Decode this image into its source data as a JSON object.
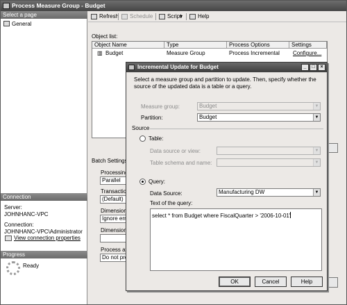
{
  "window": {
    "title": "Process Measure Group - Budget"
  },
  "left_pane": {
    "select_page_header": "Select a page",
    "pages": [
      {
        "label": "General",
        "icon": "page-icon"
      }
    ],
    "connection_header": "Connection",
    "server_label": "Server:",
    "server_value": "JOHNHANC-VPC",
    "connection_label": "Connection:",
    "connection_value": "JOHNHANC-VPC\\Administrator",
    "view_connection_properties": "View connection properties",
    "progress_header": "Progress",
    "progress_status": "Ready"
  },
  "toolbar": {
    "refresh": "Refresh",
    "schedule": "Schedule",
    "script": "Script",
    "help": "Help"
  },
  "object_list": {
    "label": "Object list:",
    "columns": [
      "Object Name",
      "Type",
      "Process Options",
      "Settings"
    ],
    "rows": [
      {
        "name": "Budget",
        "type": "Measure Group",
        "process_options": "Process Incremental",
        "settings": "Configure..."
      }
    ]
  },
  "batch_settings": {
    "label": "Batch Settings S",
    "processing_label": "Processing",
    "processing_value": "Parallel",
    "transaction_label": "Transaction",
    "transaction_value": "(Default)",
    "dimension_errors_label": "Dimension e",
    "dimension_errors_value": "Ignore error",
    "dimension_key_label": "Dimension k",
    "process_affected_label": "Process affe",
    "process_affected_value": "Do not proc"
  },
  "dialog": {
    "title": "Incremental Update for Budget",
    "description": "Select a measure group and partition to update. Then, specify whether the source of the updated data is a table or a query.",
    "measure_group_label": "Measure group:",
    "measure_group_value": "Budget",
    "partition_label": "Partition:",
    "partition_value": "Budget",
    "source_label": "Source",
    "table_label": "Table:",
    "data_source_or_view_label": "Data source or view:",
    "table_schema_label": "Table schema and name:",
    "query_label": "Query:",
    "data_source_label": "Data Source:",
    "data_source_value": "Manufacturing DW",
    "text_of_query_label": "Text of the query:",
    "query_text": "select * from Budget where FiscalQuarter > '2006-10-01'",
    "ok": "OK",
    "cancel": "Cancel",
    "help": "Help",
    "selected_source": "query"
  }
}
